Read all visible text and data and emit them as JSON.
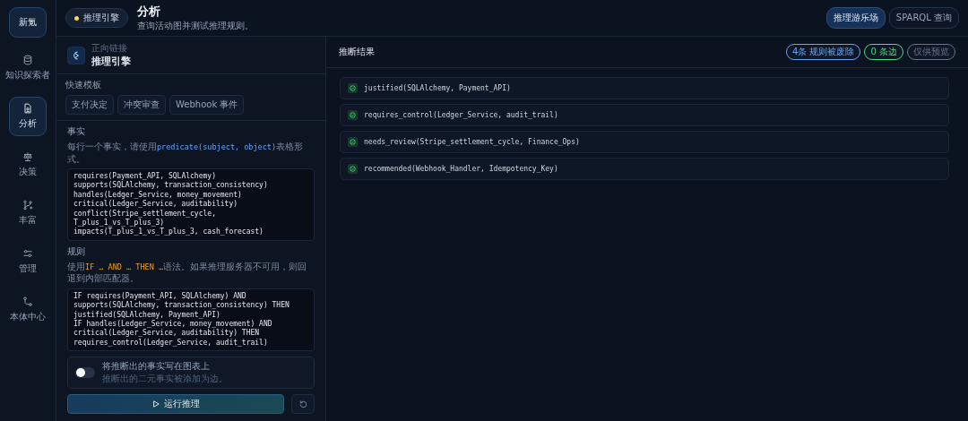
{
  "logo": "新氪",
  "sidebar": {
    "items": [
      {
        "label": "知识探索者",
        "selected": false
      },
      {
        "label": "分析",
        "selected": true
      },
      {
        "label": "决策",
        "selected": false
      },
      {
        "label": "丰富",
        "selected": false
      },
      {
        "label": "管理",
        "selected": false
      },
      {
        "label": "本体中心",
        "selected": false
      }
    ]
  },
  "header": {
    "badge": "推理引擎",
    "title": "分析",
    "subtitle": "查询活动图并测试推理规则。",
    "tabs": [
      {
        "label": "推理游乐场",
        "selected": true
      },
      {
        "label": "SPARQL 查询",
        "selected": false
      }
    ]
  },
  "engine": {
    "eyebrow": "正向链接",
    "title": "推理引擎"
  },
  "templates": {
    "label": "快速模板",
    "items": [
      "支付决定",
      "冲突审查",
      "Webhook 事件"
    ]
  },
  "facts": {
    "label": "事实",
    "hint": [
      {
        "text": "每行一个事实，请使用",
        "kind": "text"
      },
      {
        "text": "predicate(subject, object)",
        "kind": "code"
      },
      {
        "text": "表格形式。",
        "kind": "text"
      }
    ],
    "value": "requires(Payment_API, SQLAlchemy)\nsupports(SQLAlchemy, transaction_consistency)\nhandles(Ledger_Service, money_movement)\ncritical(Ledger_Service, auditability)\nconflict(Stripe_settlement_cycle,\nT_plus_1_vs_T_plus_3)\nimpacts(T_plus_1_vs_T_plus_3, cash_forecast)"
  },
  "rules": {
    "label": "规则",
    "hint": [
      {
        "text": "使用",
        "kind": "text"
      },
      {
        "text": "IF … AND … THEN …",
        "kind": "keyword"
      },
      {
        "text": "语法。如果推理服务器不可用，则回退到内部匹配器。",
        "kind": "text"
      }
    ],
    "value": "IF requires(Payment_API, SQLAlchemy) AND\nsupports(SQLAlchemy, transaction_consistency) THEN\njustified(SQLAlchemy, Payment_API)\nIF handles(Ledger_Service, money_movement) AND\ncritical(Ledger_Service, auditability) THEN\nrequires_control(Ledger_Service, audit_trail)"
  },
  "write_toggle": {
    "title": "将推断出的事实写在图表上",
    "subtitle": "推断出的二元事实被添加为边。",
    "on": false
  },
  "run_button": "运行推理",
  "results": {
    "title": "推断结果",
    "badges": [
      {
        "text": "4条 规则被废除",
        "color": "#60a5fa"
      },
      {
        "text": "0 条边",
        "color": "#4ade80"
      },
      {
        "text": "仅供预览",
        "color": "#64748b"
      }
    ],
    "items": [
      "justified(SQLAlchemy, Payment_API)",
      "requires_control(Ledger_Service, audit_trail)",
      "needs_review(Stripe_settlement_cycle, Finance_Ops)",
      "recommended(Webhook_Handler, Idempotency_Key)"
    ]
  }
}
